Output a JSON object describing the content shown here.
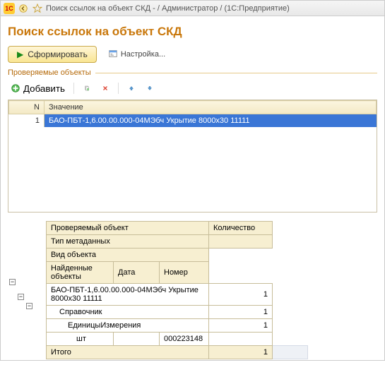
{
  "titlebar": {
    "app_logo": "1C",
    "title": "Поиск ссылок на объект СКД - / Администратор /  (1С:Предприятие)"
  },
  "page": {
    "title": "Поиск ссылок на объект СКД"
  },
  "toolbar": {
    "run_label": "Сформировать",
    "settings_label": "Настройка..."
  },
  "section": {
    "checked_objects": "Проверяемые объекты"
  },
  "row_toolbar": {
    "add_label": "Добавить"
  },
  "grid1": {
    "col_n": "N",
    "col_value": "Значение",
    "rows": [
      {
        "n": "1",
        "value": "БАО-ПБТ-1,6.00.00.000-04МЭбч Укрытие 8000х30 11111"
      }
    ]
  },
  "grid2": {
    "headers": {
      "object": "Проверяемый объект",
      "qty": "Количество",
      "meta_type": "Тип метаданных",
      "obj_type": "Вид объекта",
      "found": "Найденные объекты",
      "date": "Дата",
      "number": "Номер"
    },
    "rows": {
      "r1_obj": "БАО-ПБТ-1,6.00.00.000-04МЭбч Укрытие 8000х30 11111",
      "r1_qty": "1",
      "r2_obj": "Справочник",
      "r2_qty": "1",
      "r3_obj": "ЕдиницыИзмерения",
      "r3_qty": "1",
      "r4_obj": "шт",
      "r4_num": "000223148",
      "total_label": "Итого",
      "total_qty": "1"
    }
  }
}
